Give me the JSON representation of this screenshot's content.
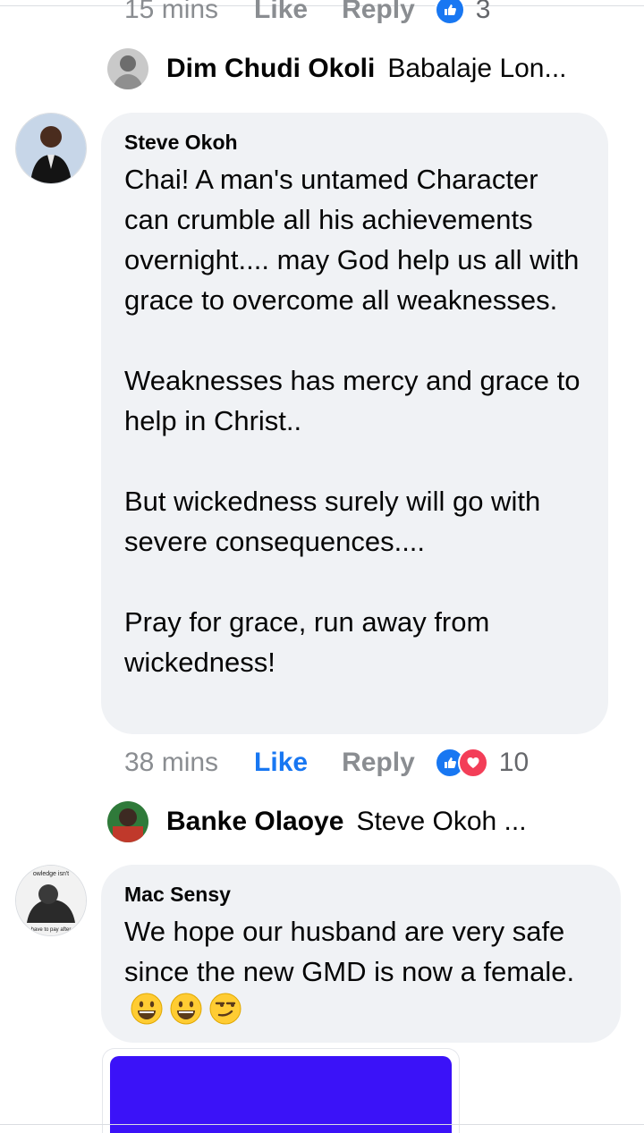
{
  "comment0_meta": {
    "time": "15 mins",
    "like": "Like",
    "reply": "Reply",
    "reaction_count": "3"
  },
  "reply_preview1": {
    "name": "Dim Chudi Okoli",
    "snippet": "Babalaje Lon..."
  },
  "comment1": {
    "author": "Steve Okoh",
    "text": "Chai! A man's untamed Character can crumble all his achievements overnight.... may God help us all with grace to overcome all weaknesses.\n\nWeaknesses has mercy and grace to help in Christ..\n\nBut wickedness surely will go with severe consequences....\n\nPray for grace,  run away from wickedness!",
    "time": "38 mins",
    "like": "Like",
    "reply": "Reply",
    "reaction_count": "10"
  },
  "reply_preview2": {
    "name": "Banke Olaoye",
    "snippet": "Steve Okoh ..."
  },
  "comment2": {
    "author": "Mac Sensy",
    "text": "We hope our husband are very safe since the new GMD is now a female.",
    "avatar_text_top": "owledge isn't",
    "avatar_text_bottom": "have to pay after"
  },
  "colors": {
    "like_blue": "#1877f2",
    "love_red": "#f33e58",
    "bubble_bg": "#f0f2f5",
    "meta_gray": "#8a8d91",
    "media_blue": "#3b12f8"
  }
}
